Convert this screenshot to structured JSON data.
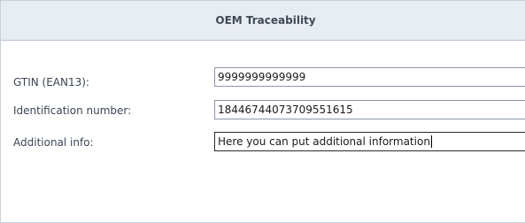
{
  "header": {
    "title": "OEM Traceability"
  },
  "form": {
    "gtin": {
      "label": "GTIN (EAN13):",
      "value": "9999999999999"
    },
    "identification_number": {
      "label": "Identification number:",
      "value": "18446744073709551615"
    },
    "additional_info": {
      "label": "Additional info:",
      "value": "Here you can put additional information"
    }
  }
}
